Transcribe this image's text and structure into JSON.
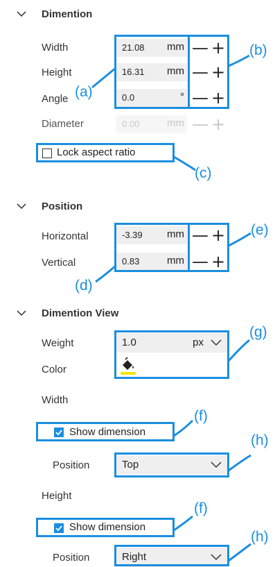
{
  "dimension": {
    "title": "Dimention",
    "width_label": "Width",
    "width_value": "21.08",
    "width_unit": "mm",
    "height_label": "Height",
    "height_value": "16.31",
    "height_unit": "mm",
    "angle_label": "Angle",
    "angle_value": "0.0",
    "angle_unit": "°",
    "diameter_label": "Diameter",
    "diameter_value": "0.00",
    "diameter_unit": "mm",
    "lock_label": "Lock aspect ratio",
    "lock_checked": false
  },
  "position": {
    "title": "Position",
    "horizontal_label": "Horizontal",
    "horizontal_value": "-3.39",
    "horizontal_unit": "mm",
    "vertical_label": "Vertical",
    "vertical_value": "0.83",
    "vertical_unit": "mm"
  },
  "dimension_view": {
    "title": "Dimention View",
    "weight_label": "Weight",
    "weight_value": "1.0",
    "weight_unit": "px",
    "color_label": "Color",
    "color_swatch": "#f2e600",
    "width_heading": "Width",
    "width_show_label": "Show dimension",
    "width_show_checked": true,
    "width_position_label": "Position",
    "width_position_value": "Top",
    "height_heading": "Height",
    "height_show_label": "Show dimension",
    "height_show_checked": true,
    "height_position_label": "Position",
    "height_position_value": "Right"
  },
  "stepper": {
    "minus": "—",
    "plus": "+"
  },
  "callouts": {
    "a": "(a)",
    "b": "(b)",
    "c": "(c)",
    "d": "(d)",
    "e": "(e)",
    "f1": "(f)",
    "g": "(g)",
    "f2": "(f)",
    "h1": "(h)",
    "h2": "(h)"
  },
  "colors": {
    "accent": "#1a8ee0",
    "field_bg": "#efefef"
  },
  "icons": {
    "chevron": "chevron-down-icon",
    "paint": "paint-bucket-icon",
    "check": "check-icon"
  }
}
